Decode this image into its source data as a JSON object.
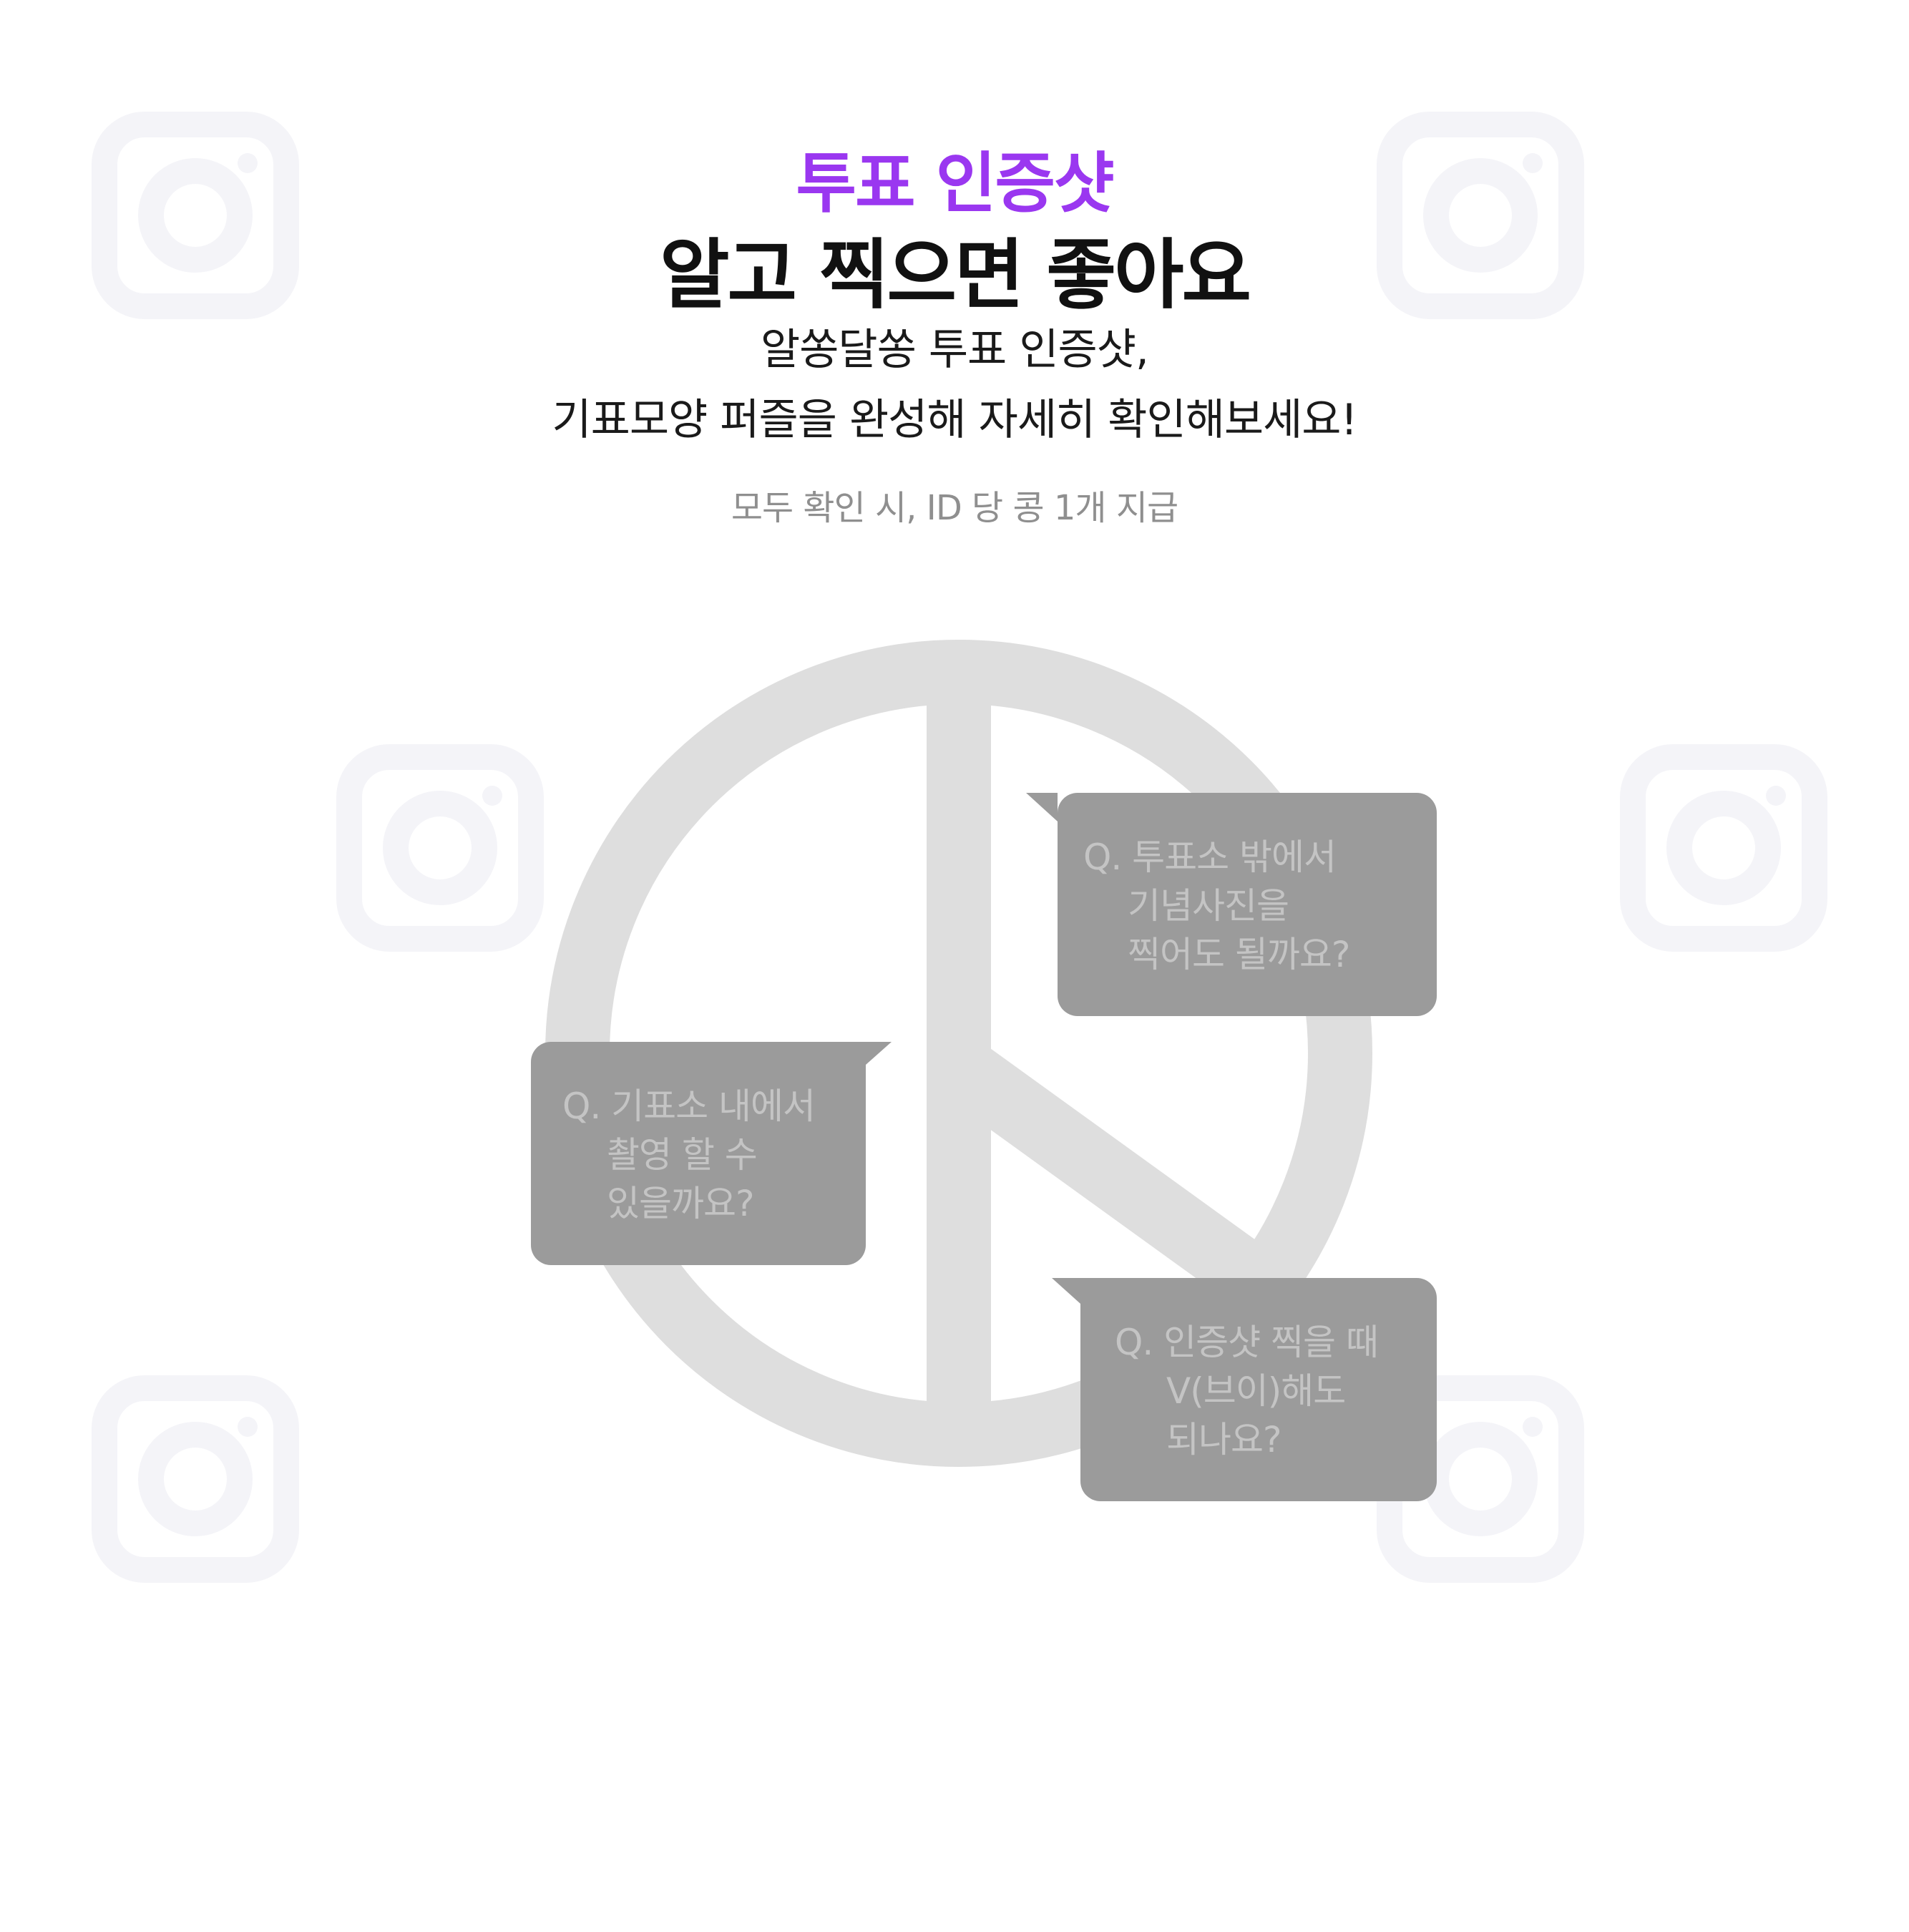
{
  "header": {
    "accent_title": "투표 인증샷",
    "main_title": "알고 찍으면 좋아요",
    "subtitle_line1": "알쏭달쏭 투표 인증샷,",
    "subtitle_line2": "기표모양 퍼즐을 완성해 자세히 확인해보세요!",
    "note": "모두 확인 시, ID 당 콩 1개 지급"
  },
  "questions": [
    {
      "prefix": "Q.",
      "lines": [
        "투표소 밖에서",
        "기념사진을",
        "찍어도 될까요?"
      ]
    },
    {
      "prefix": "Q.",
      "lines": [
        "기표소 내에서",
        "촬영 할 수",
        "있을까요?"
      ]
    },
    {
      "prefix": "Q.",
      "lines": [
        "인증샷 찍을 때",
        "V(브이)해도",
        "되나요?"
      ]
    }
  ],
  "colors": {
    "accent": "#9a37f0",
    "title": "#111111",
    "note": "#8f8f8f",
    "symbol": "#dedede",
    "bubble": "#9b9b9b",
    "bubble_text": "#c4c4c4",
    "icon": "#f4f4f8"
  },
  "icons": {
    "background_icon": "camera-icon",
    "center_symbol": "ballot-stamp-symbol"
  }
}
